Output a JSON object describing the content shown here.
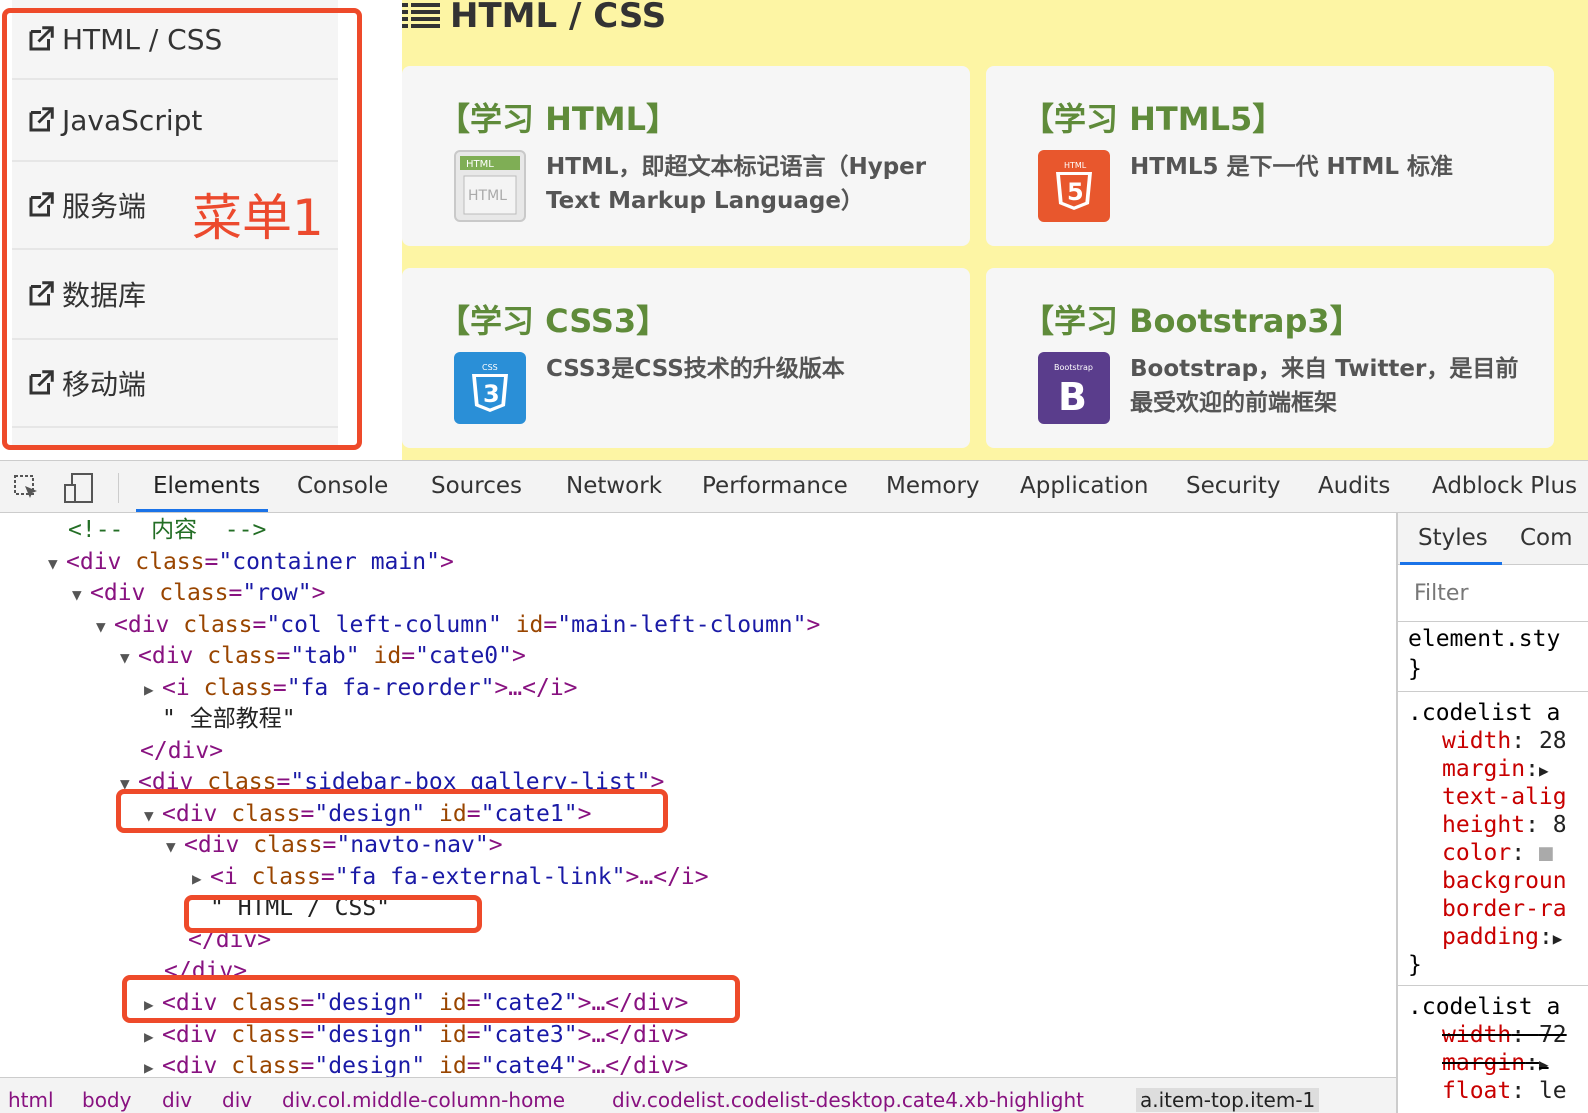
{
  "sidebar": {
    "items": [
      {
        "label": "HTML / CSS"
      },
      {
        "label": "JavaScript"
      },
      {
        "label": "服务端"
      },
      {
        "label": "数据库"
      },
      {
        "label": "移动端"
      }
    ],
    "annotation": "菜单1"
  },
  "content": {
    "title": "HTML / CSS",
    "cards": [
      {
        "title": "【学习 HTML】",
        "desc": "HTML，即超文本标记语言（Hyper Text Markup Language）",
        "logo_text": "HTML"
      },
      {
        "title": "【学习 HTML5】",
        "desc": "HTML5 是下一代 HTML 标准",
        "logo_text": "5"
      },
      {
        "title": "【学习 CSS3】",
        "desc": "CSS3是CSS技术的升级版本",
        "logo_text": "3"
      },
      {
        "title": "【学习 Bootstrap3】",
        "desc": "Bootstrap，来自 Twitter，是目前最受欢迎的前端框架",
        "logo_text": "B"
      }
    ]
  },
  "devtools": {
    "tabs": [
      "Elements",
      "Console",
      "Sources",
      "Network",
      "Performance",
      "Memory",
      "Application",
      "Security",
      "Audits",
      "Adblock Plus"
    ],
    "active_tab": "Elements",
    "dom": [
      {
        "pre": "<!--  ",
        "cmt": "内容",
        "post": "  -->"
      },
      {
        "tag": "div",
        "attrs": [
          [
            "class",
            "container main"
          ]
        ]
      },
      {
        "tag": "div",
        "attrs": [
          [
            "class",
            "row"
          ]
        ]
      },
      {
        "tag": "div",
        "attrs": [
          [
            "class",
            "col left-column"
          ],
          [
            "id",
            "main-left-cloumn"
          ]
        ]
      },
      {
        "tag": "div",
        "attrs": [
          [
            "class",
            "tab"
          ],
          [
            "id",
            "cate0"
          ]
        ]
      },
      {
        "tag": "i",
        "attrs": [
          [
            "class",
            "fa fa-reorder"
          ]
        ],
        "collapsed": "…</i>"
      },
      {
        "text": "\" 全部教程\""
      },
      {
        "close": "</div>"
      },
      {
        "tag": "div",
        "attrs": [
          [
            "class",
            "sidebar-box gallery-list"
          ]
        ]
      },
      {
        "tag": "div",
        "attrs": [
          [
            "class",
            "design"
          ],
          [
            "id",
            "cate1"
          ]
        ]
      },
      {
        "tag": "div",
        "attrs": [
          [
            "class",
            "navto-nav"
          ]
        ]
      },
      {
        "tag": "i",
        "attrs": [
          [
            "class",
            "fa fa-external-link"
          ]
        ],
        "collapsed": "…</i>"
      },
      {
        "text": "\" HTML / CSS\""
      },
      {
        "close": "</div>"
      },
      {
        "close": "</div>"
      },
      {
        "tag": "div",
        "attrs": [
          [
            "class",
            "design"
          ],
          [
            "id",
            "cate2"
          ]
        ],
        "collapsed": "…</div>"
      },
      {
        "tag": "div",
        "attrs": [
          [
            "class",
            "design"
          ],
          [
            "id",
            "cate3"
          ]
        ],
        "collapsed": "…</div>"
      },
      {
        "tag": "div",
        "attrs": [
          [
            "class",
            "design"
          ],
          [
            "id",
            "cate4"
          ]
        ],
        "collapsed": "…</div>"
      }
    ],
    "styles": {
      "tabs": [
        "Styles",
        "Com"
      ],
      "filter_placeholder": "Filter",
      "element_style": "element.sty",
      "rule1_selector": ".codelist a",
      "rule1_props": [
        [
          "width",
          "28"
        ],
        [
          "margin",
          "▶"
        ],
        [
          "text-alig",
          ""
        ],
        [
          "height",
          "8"
        ],
        [
          "color",
          "■"
        ],
        [
          "backgroun",
          ""
        ],
        [
          "border-ra",
          ""
        ],
        [
          "padding",
          "▶"
        ]
      ],
      "rule2_selector": ".codelist a",
      "rule2_props": [
        [
          "width",
          "72"
        ],
        [
          "margin",
          "▶"
        ],
        [
          "float",
          "le"
        ]
      ]
    },
    "breadcrumb": [
      "html",
      "body",
      "div",
      "div",
      "div.col.middle-column-home",
      "div.codelist.codelist-desktop.cate4.xb-highlight",
      "a.item-top.item-1"
    ]
  },
  "colors": {
    "annotation_red": "#ee4a2a",
    "content_bg": "#fdf5a4",
    "card_title_green": "#5f8b3a",
    "tab_underline": "#1a73e8"
  }
}
